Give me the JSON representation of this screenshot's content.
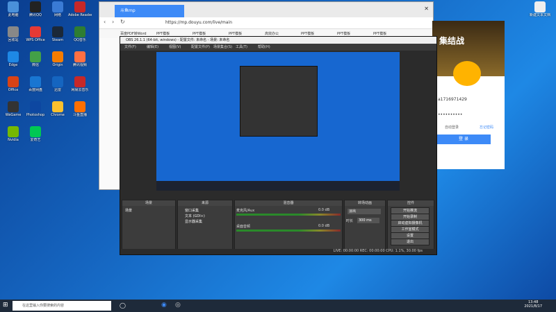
{
  "desktop_icons": [
    {
      "label": "此电脑",
      "color": "#4a90d9"
    },
    {
      "label": "腾讯QQ",
      "color": "#222"
    },
    {
      "label": "网络",
      "color": "#3a7bd5"
    },
    {
      "label": "Adobe Reader",
      "color": "#c62828"
    },
    {
      "label": "回收站",
      "color": "#888"
    },
    {
      "label": "WPS Office",
      "color": "#e53935"
    },
    {
      "label": "Steam",
      "color": "#1b2838"
    },
    {
      "label": "QQ音乐",
      "color": "#2e7d32"
    },
    {
      "label": "Edge",
      "color": "#1e88e5"
    },
    {
      "label": "微信",
      "color": "#43a047"
    },
    {
      "label": "Origin",
      "color": "#f57c00"
    },
    {
      "label": "腾讯视频",
      "color": "#ff7043"
    },
    {
      "label": "Office",
      "color": "#d84315"
    },
    {
      "label": "百度网盘",
      "color": "#1976d2"
    },
    {
      "label": "迅雷",
      "color": "#1565c0"
    },
    {
      "label": "网易云音乐",
      "color": "#c62828"
    },
    {
      "label": "WeGame",
      "color": "#333"
    },
    {
      "label": "Photoshop",
      "color": "#0d47a1"
    },
    {
      "label": "Chrome",
      "color": "#fbc02d"
    },
    {
      "label": "斗鱼直播",
      "color": "#ff6f00"
    },
    {
      "label": "Nvidia",
      "color": "#76b900"
    },
    {
      "label": "爱奇艺",
      "color": "#00c853"
    }
  ],
  "browser": {
    "tab_label": "斗鱼mp",
    "url": "https://mp.douyu.com/live/main",
    "bookmarks": [
      "百度PDF转Word",
      "PPT模板",
      "PPT模板",
      "PPT模板",
      "高效办公",
      "PPT模板",
      "PPT模板",
      "PPT模板"
    ]
  },
  "login": {
    "banner_text": "集结战",
    "account": "a1716971429",
    "password": "••••••••••",
    "remember": "自动登录",
    "forgot": "忘记密码",
    "login_button": "登 录"
  },
  "obs": {
    "title": "OBS 26.1.1 (64-bit, windows) - 配置文件: 未命名 - 场景: 未命名",
    "menu": [
      "文件(F)",
      "编辑(E)",
      "视图(V)",
      "配置文件(P)",
      "场景集合(S)",
      "工具(T)",
      "帮助(H)"
    ],
    "scenes_title": "场景",
    "sources_title": "来源",
    "mixer_title": "混音器",
    "transitions_title": "转场动画",
    "controls_title": "控件",
    "scenes": [
      "场景"
    ],
    "sources": [
      "窗口采集",
      "文本 (GDI+)",
      "显示器采集"
    ],
    "mixer_tracks": [
      {
        "label": "麦克风/Aux",
        "level": "0.0 dB"
      },
      {
        "label": "桌面音频",
        "level": "0.0 dB"
      }
    ],
    "transition": "淡出",
    "duration_label": "时长",
    "duration": "300 ms",
    "controls": [
      "开始推流",
      "开始录制",
      "启动虚拟摄像机",
      "工作室模式",
      "设置",
      "退出"
    ],
    "status": "LIVE: 00:00:00   REC: 00:00:00   CPU: 1.1%, 30.00 fps"
  },
  "taskbar": {
    "search_placeholder": "在这里输入你要搜索的内容",
    "time": "13:48",
    "date": "2021/8/17"
  },
  "newdoc_label": "新建文本文档"
}
